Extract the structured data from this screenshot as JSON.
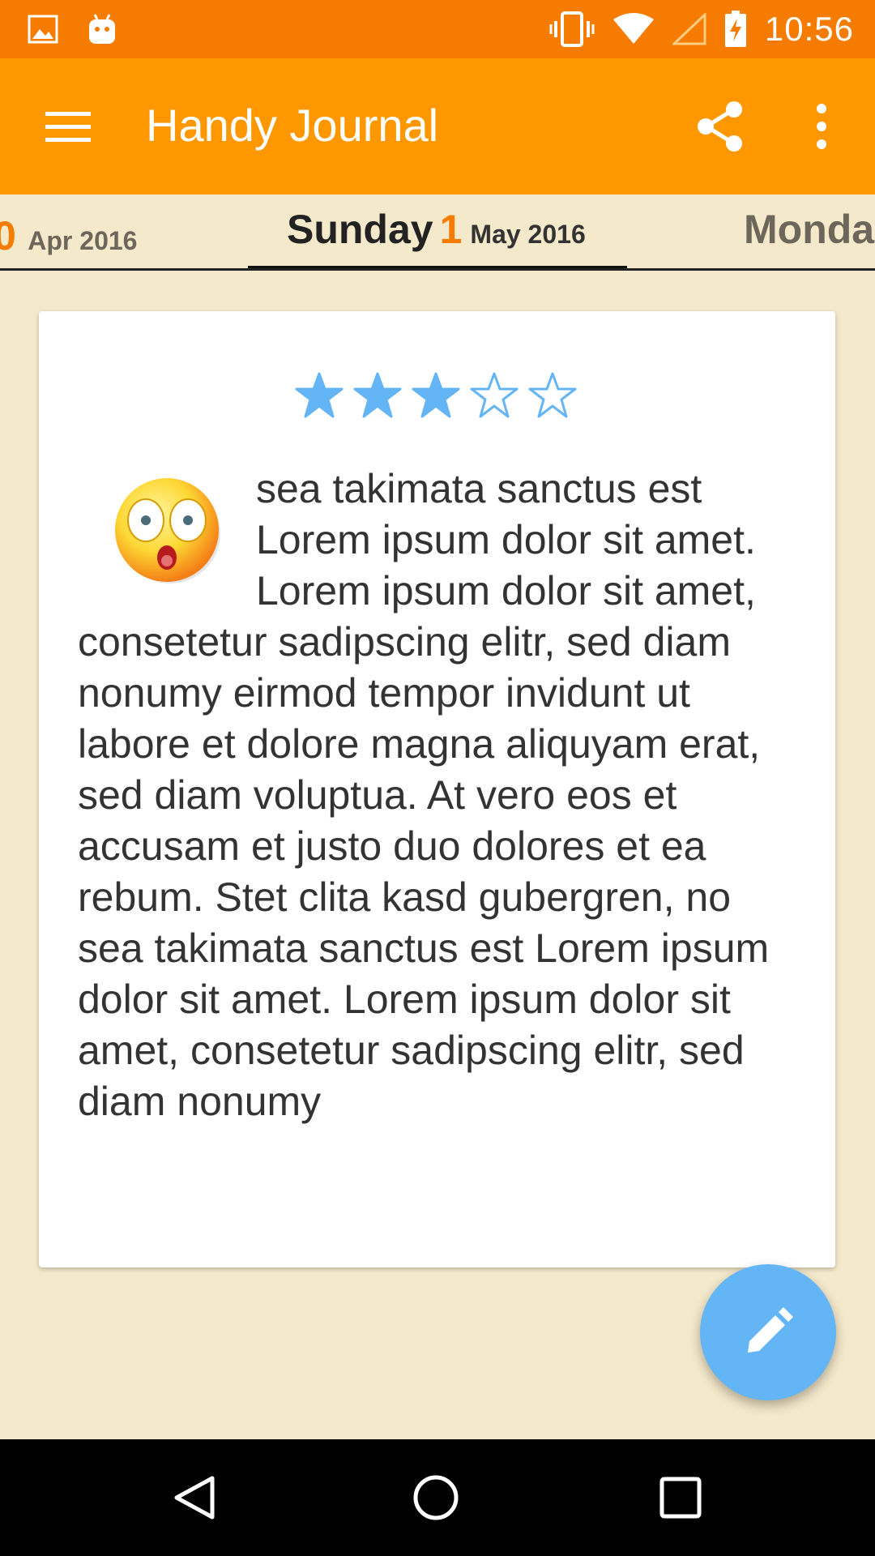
{
  "status_bar": {
    "time": "10:56",
    "left_icons": [
      "image-icon",
      "android-icon"
    ],
    "right_icons": [
      "vibrate-icon",
      "wifi-icon",
      "signal-icon",
      "battery-charging-icon"
    ]
  },
  "app_bar": {
    "title": "Handy Journal",
    "color": "#ff9800",
    "icons": [
      "menu-icon",
      "share-icon",
      "more-vert-icon"
    ]
  },
  "day_tabs": {
    "prev": {
      "day_num": "0",
      "month_year": "Apr 2016"
    },
    "current": {
      "day_name": "Sunday",
      "day_num": "1",
      "month_year": "May 2016"
    },
    "next": {
      "day_name": "Monda"
    }
  },
  "entry": {
    "rating": 3,
    "rating_max": 5,
    "mood_icon": "shocked-face-icon",
    "text": "sea takimata sanctus est Lorem ipsum dolor sit amet. Lorem ipsum dolor sit amet, consetetur sadipscing elitr, sed diam nonumy eirmod tempor invidunt ut labore et dolore magna aliquyam erat, sed diam voluptua. At vero eos et accusam et justo duo dolores et ea rebum. Stet clita kasd gubergren, no sea takimata sanctus est Lorem ipsum dolor sit amet. Lorem ipsum dolor sit amet, consetetur sadipscing elitr, sed diam nonumy"
  },
  "fab": {
    "icon": "edit-pencil-icon",
    "color": "#64b5f6"
  },
  "nav_bar": {
    "icons": [
      "back-icon",
      "home-icon",
      "recents-icon"
    ]
  },
  "colors": {
    "status_bar": "#f57c00",
    "background": "#f5e9cb",
    "accent": "#f57c00",
    "star": "#64b5f6"
  }
}
